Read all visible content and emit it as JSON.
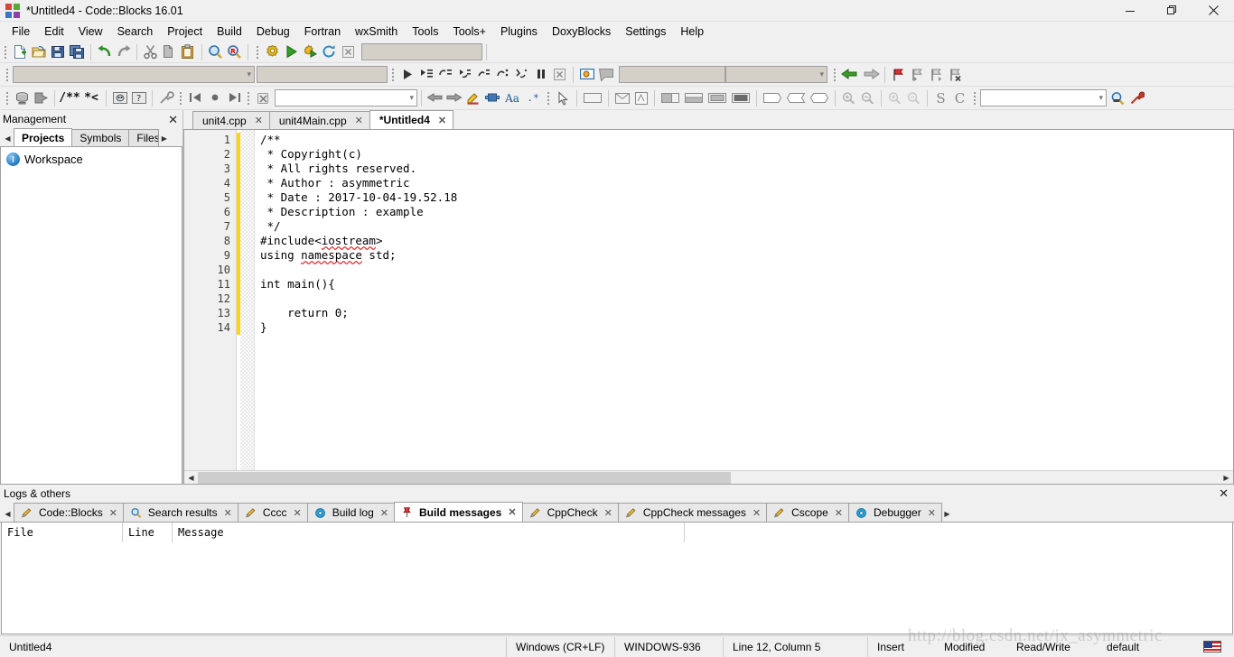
{
  "window": {
    "title": "*Untitled4 - Code::Blocks 16.01",
    "minimize": "minimize-icon",
    "maximize": "restore-icon",
    "close": "close-icon"
  },
  "menubar": {
    "items": [
      "File",
      "Edit",
      "View",
      "Search",
      "Project",
      "Build",
      "Debug",
      "Fortran",
      "wxSmith",
      "Tools",
      "Tools+",
      "Plugins",
      "DoxyBlocks",
      "Settings",
      "Help"
    ]
  },
  "toolbars": {
    "row1": {
      "group1": [
        "new-file-icon",
        "open-file-icon",
        "save-icon",
        "save-all-icon"
      ],
      "group2": [
        "undo-icon",
        "redo-icon"
      ],
      "group3": [
        "cut-icon",
        "copy-icon",
        "paste-icon"
      ],
      "group4": [
        "find-icon",
        "replace-icon"
      ],
      "group5": [
        "build-icon",
        "run-icon",
        "build-and-run-icon",
        "rebuild-icon",
        "abort-icon"
      ],
      "build_target_value": "",
      "build_target_placeholder": ""
    },
    "row2": {
      "compiler_select_value": "",
      "debug_group": [
        "debug-continue-icon",
        "debug-run-to-cursor-icon",
        "debug-next-line-icon",
        "debug-step-into-icon",
        "debug-step-out-icon",
        "debug-next-instruction-icon",
        "debug-step-into-instruction-icon",
        "debug-break-icon",
        "debug-stop-icon"
      ],
      "debug_windows": [
        "debugging-windows-icon",
        "various-info-icon"
      ],
      "nav_group": [
        "back-icon",
        "forward-icon"
      ],
      "bookmark_group": [
        "toggle-bookmark-icon",
        "previous-bookmark-icon",
        "next-bookmark-icon",
        "clear-bookmarks-icon"
      ]
    },
    "row3": {
      "doxy_group": [
        "doxyblocks-run-icon",
        "doxyblocks-extract-icon"
      ],
      "comment_group": [
        "doxy-comment-block-icon",
        "doxy-comment-line-icon"
      ],
      "doxy_view": [
        "doxy-preview-icon",
        "doxy-help-icon"
      ],
      "doxy_config": [
        "doxy-settings-icon"
      ],
      "wxsmith_nav": [
        "goto-first-icon",
        "goto-record-icon",
        "goto-last-icon"
      ],
      "wxsmith_clear": [
        "clear-icon"
      ],
      "wxsmith_combo_value": "",
      "fortran_nav": [
        "fortran-back-icon",
        "fortran-forward-icon"
      ],
      "fortran_tools": [
        "fortran-marker-icon",
        "fortran-module-icon",
        "fortran-case-icon",
        "fortran-wildcard-icon"
      ],
      "wx_pointer": [
        "pointer-icon"
      ],
      "wx_basic": [
        "panel-icon"
      ],
      "wx_dialog": [
        "dialog-icon",
        "frame-icon"
      ],
      "wx_layout": [
        "box-sizer-icon",
        "static-box-sizer-icon",
        "grid-sizer-icon",
        "flex-grid-sizer-icon"
      ],
      "wx_spacer": [
        "spacer-icon",
        "stretch-spacer-icon",
        "grow-spacer-icon"
      ],
      "wx_zoom": [
        "zoom-in-icon",
        "zoom-out-icon"
      ],
      "wx_extra": [
        "zoom-in-2-icon",
        "zoom-out-2-icon"
      ],
      "symbol_s": "S",
      "symbol_c": "C",
      "search_combo_value": "",
      "search_tools": [
        "search-decl-icon",
        "configure-icon"
      ]
    }
  },
  "management": {
    "title": "Management",
    "close": "close-icon",
    "scroll_left": "scroll-left-icon",
    "scroll_right": "scroll-right-icon",
    "tabs": [
      {
        "label": "Projects",
        "active": true
      },
      {
        "label": "Symbols",
        "active": false
      },
      {
        "label": "Files",
        "active": false
      }
    ],
    "tree": [
      {
        "label": "Workspace",
        "icon": "workspace-icon"
      }
    ]
  },
  "editor": {
    "tabs": [
      {
        "label": "unit4.cpp",
        "active": false
      },
      {
        "label": "unit4Main.cpp",
        "active": false
      },
      {
        "label": "*Untitled4",
        "active": true
      }
    ],
    "close_glyph": "✕",
    "lines": [
      {
        "num": 1,
        "text": "/**",
        "modified": true
      },
      {
        "num": 2,
        "text": " * Copyright(c)",
        "modified": true
      },
      {
        "num": 3,
        "text": " * All rights reserved.",
        "modified": true
      },
      {
        "num": 4,
        "text": " * Author : asymmetric",
        "modified": true
      },
      {
        "num": 5,
        "text": " * Date : 2017-10-04-19.52.18",
        "modified": true
      },
      {
        "num": 6,
        "text": " * Description : example",
        "modified": true
      },
      {
        "num": 7,
        "text": " */",
        "modified": true
      },
      {
        "num": 8,
        "text": "#include<iostream>",
        "modified": true,
        "spell": [
          "iostream"
        ]
      },
      {
        "num": 9,
        "text": "using namespace std;",
        "modified": true,
        "spell": [
          "namespace"
        ]
      },
      {
        "num": 10,
        "text": "",
        "modified": true
      },
      {
        "num": 11,
        "text": "int main(){",
        "modified": true
      },
      {
        "num": 12,
        "text": "",
        "modified": true
      },
      {
        "num": 13,
        "text": "    return 0;",
        "modified": true
      },
      {
        "num": 14,
        "text": "}",
        "modified": true
      }
    ],
    "hscroll_left": "scroll-left-icon",
    "hscroll_right": "scroll-right-icon"
  },
  "logs": {
    "title": "Logs & others",
    "close": "close-icon",
    "scroll_left": "scroll-left-icon",
    "scroll_right": "scroll-right-icon",
    "tabs": [
      {
        "label": "Code::Blocks",
        "icon": "pencil-icon",
        "active": false
      },
      {
        "label": "Search results",
        "icon": "magnifier-icon",
        "active": false
      },
      {
        "label": "Cccc",
        "icon": "pencil-icon",
        "active": false
      },
      {
        "label": "Build log",
        "icon": "gear-blue-icon",
        "active": false
      },
      {
        "label": "Build messages",
        "icon": "pushpin-icon",
        "active": true
      },
      {
        "label": "CppCheck",
        "icon": "pencil-icon",
        "active": false
      },
      {
        "label": "CppCheck messages",
        "icon": "pencil-icon",
        "active": false
      },
      {
        "label": "Cscope",
        "icon": "pencil-icon",
        "active": false
      },
      {
        "label": "Debugger",
        "icon": "gear-blue-icon",
        "active": false
      }
    ],
    "columns": [
      "File",
      "Line",
      "Message"
    ],
    "rows": []
  },
  "statusbar": {
    "cells": [
      "Untitled4",
      "Windows (CR+LF)",
      "WINDOWS-936",
      "Line 12, Column 5",
      "Insert",
      "Modified",
      "Read/Write",
      "default"
    ],
    "keyboard_icon": "us-flag-icon"
  },
  "watermark": "http://blog.csdn.net/jx_asymmetric"
}
